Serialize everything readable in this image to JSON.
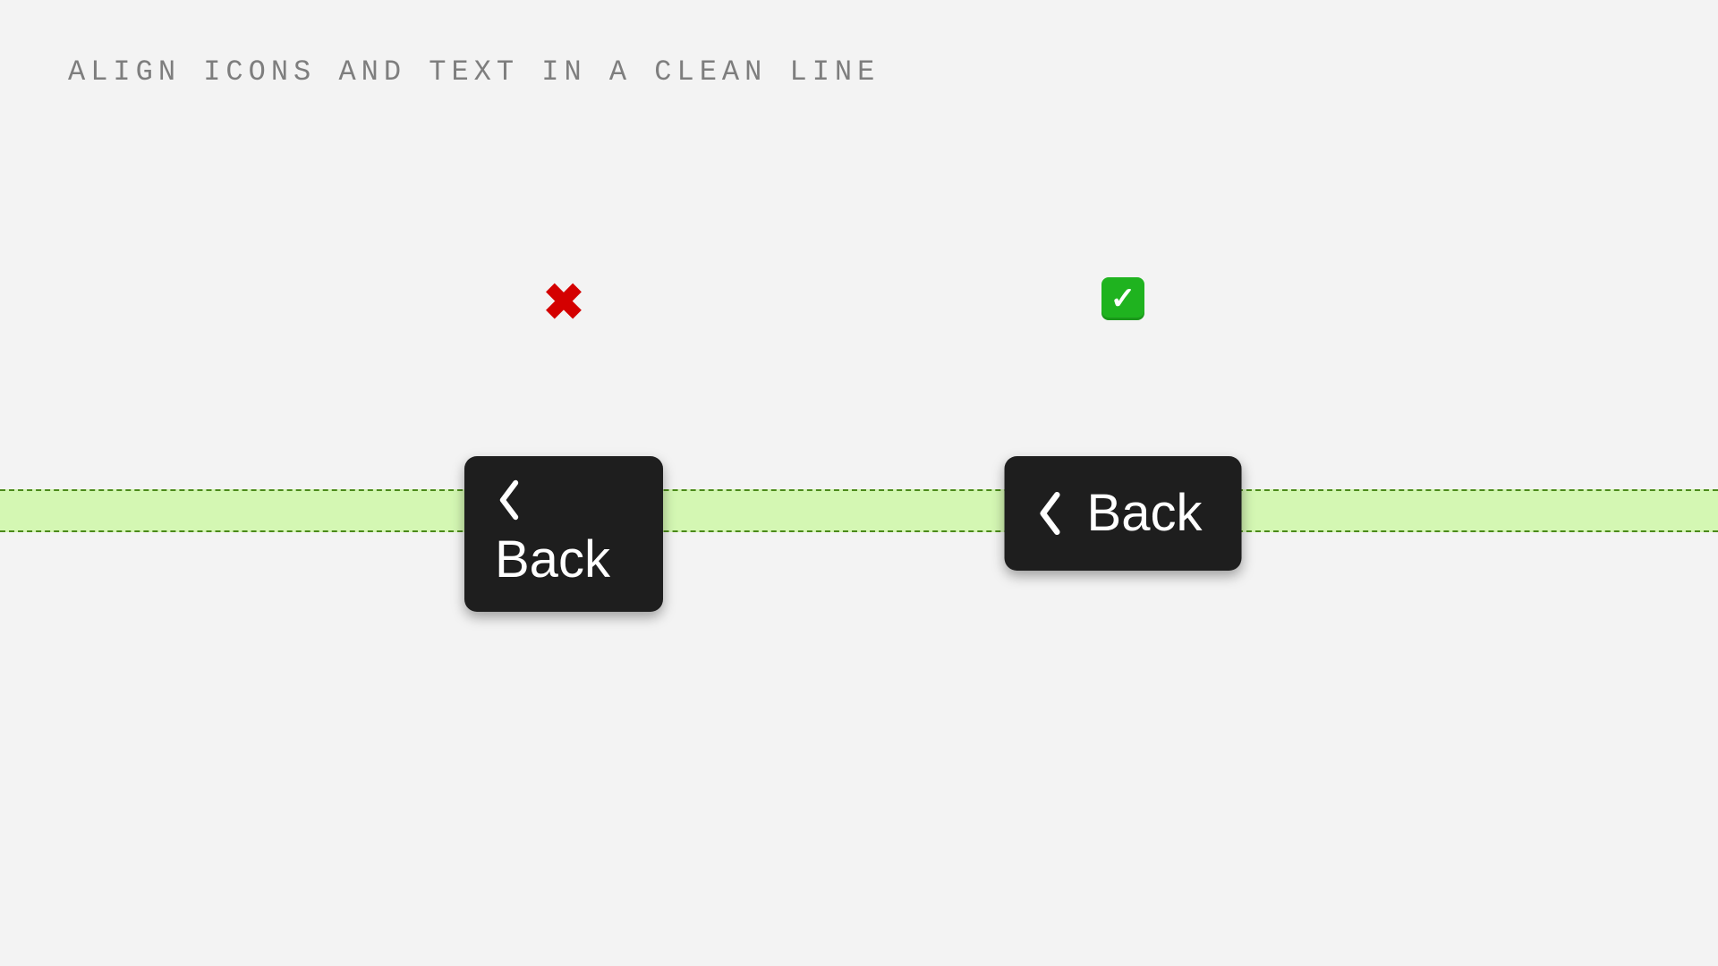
{
  "heading": "ALIGN ICONS AND TEXT IN A CLEAN LINE",
  "status": {
    "bad_symbol": "✖",
    "good_symbol": "✓"
  },
  "buttons": {
    "bad_label": "Back",
    "good_label": "Back"
  },
  "colors": {
    "background": "#f3f3f3",
    "strip_fill": "#d4f7b3",
    "strip_border": "#4b8a1a",
    "button_bg": "#1e1e1e",
    "button_fg": "#ffffff",
    "heading_fg": "#7e7e7e",
    "cross_fg": "#d40000",
    "check_bg": "#1fb31f"
  }
}
